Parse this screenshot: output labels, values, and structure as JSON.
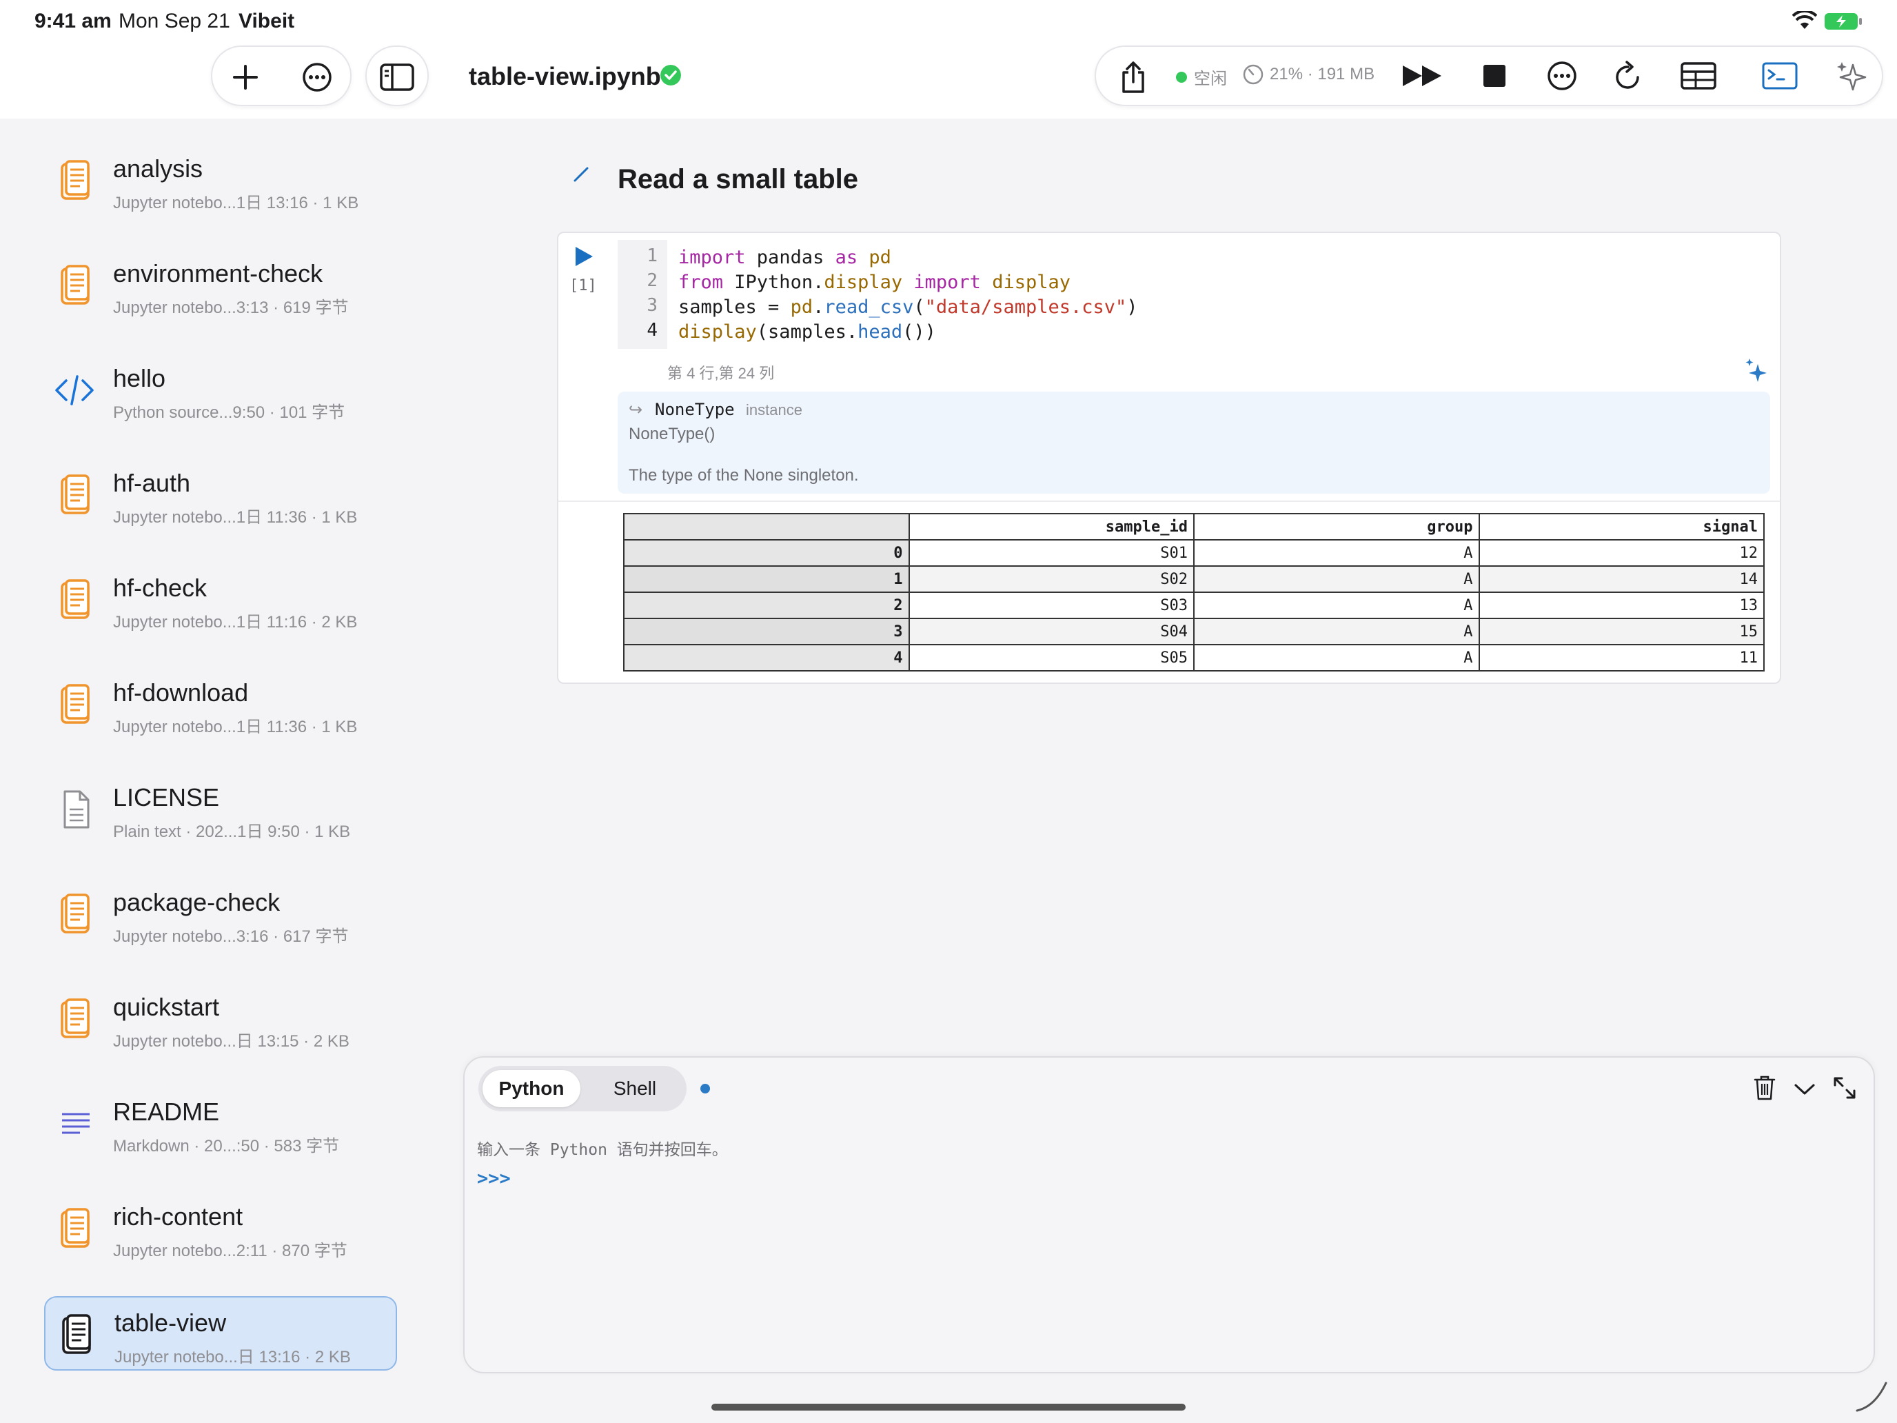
{
  "status_bar": {
    "time": "9:41 am",
    "date": "Mon Sep 21",
    "app": "Vibeit"
  },
  "toolbar": {
    "add_icon": "plus-icon",
    "more_icon": "ellipsis-circle-icon",
    "sidebar_icon": "sidebar-toggle-icon",
    "title": "table-view.ipynb",
    "saved_icon": "check-circle-icon",
    "share_icon": "share-icon",
    "kernel_status": "空闲",
    "kernel_usage": "21% · 191 MB",
    "run_all_icon": "run-all-icon",
    "stop_icon": "stop-icon",
    "menu_icon": "ellipsis-circle-icon",
    "restart_icon": "restart-icon",
    "table_icon": "table-icon",
    "console_icon": "terminal-icon",
    "ai_icon": "sparkles-icon",
    "accent": "#1a6fc0",
    "ok_color": "#34c759"
  },
  "sidebar": {
    "items": [
      {
        "name": "analysis",
        "meta": "Jupyter notebo...1日 13:16 · 1 KB",
        "icon": "notebook-icon"
      },
      {
        "name": "environment-check",
        "meta": "Jupyter notebo...3:13 · 619 字节",
        "icon": "notebook-icon"
      },
      {
        "name": "hello",
        "meta": "Python source...9:50 · 101 字节",
        "icon": "code-icon"
      },
      {
        "name": "hf-auth",
        "meta": "Jupyter notebo...1日 11:36 · 1 KB",
        "icon": "notebook-icon"
      },
      {
        "name": "hf-check",
        "meta": "Jupyter notebo...1日 11:16 · 2 KB",
        "icon": "notebook-icon"
      },
      {
        "name": "hf-download",
        "meta": "Jupyter notebo...1日 11:36 · 1 KB",
        "icon": "notebook-icon"
      },
      {
        "name": "LICENSE",
        "meta": "Plain text · 202...1日 9:50 · 1 KB",
        "icon": "document-icon"
      },
      {
        "name": "package-check",
        "meta": "Jupyter notebo...3:16 · 617 字节",
        "icon": "notebook-icon"
      },
      {
        "name": "quickstart",
        "meta": "Jupyter notebo...日 13:15 · 2 KB",
        "icon": "notebook-icon"
      },
      {
        "name": "README",
        "meta": "Markdown · 20...:50 · 583 字节",
        "icon": "markdown-icon"
      },
      {
        "name": "rich-content",
        "meta": "Jupyter notebo...2:11 · 870 字节",
        "icon": "notebook-icon"
      },
      {
        "name": "table-view",
        "meta": "Jupyter notebo...日 13:16 · 2 KB",
        "icon": "notebook-icon",
        "selected": true
      }
    ]
  },
  "notebook": {
    "markdown_heading": "Read a small table",
    "code_cell": {
      "exec_count": "[1]",
      "line_numbers": [
        "1",
        "2",
        "3",
        "4"
      ],
      "lines": [
        [
          {
            "t": "import",
            "c": "kw"
          },
          {
            "t": " pandas "
          },
          {
            "t": "as",
            "c": "kw"
          },
          {
            "t": " "
          },
          {
            "t": "pd",
            "c": "mod"
          }
        ],
        [
          {
            "t": "from",
            "c": "kw"
          },
          {
            "t": " IPython."
          },
          {
            "t": "display",
            "c": "mod"
          },
          {
            "t": " "
          },
          {
            "t": "import",
            "c": "kw"
          },
          {
            "t": " "
          },
          {
            "t": "display",
            "c": "mod"
          }
        ],
        [
          {
            "t": "samples = "
          },
          {
            "t": "pd",
            "c": "mod"
          },
          {
            "t": "."
          },
          {
            "t": "read_csv",
            "c": "fn"
          },
          {
            "t": "("
          },
          {
            "t": "\"data/samples.csv\"",
            "c": "str"
          },
          {
            "t": ")"
          }
        ],
        [
          {
            "t": "display",
            "c": "mod"
          },
          {
            "t": "(samples."
          },
          {
            "t": "head",
            "c": "fn"
          },
          {
            "t": "())"
          }
        ]
      ],
      "cursor_position": "第 4 行,第 24 列"
    },
    "tooltip": {
      "arrow": "↪",
      "type_name": "NoneType",
      "kind": "instance",
      "signature": "NoneType()",
      "doc": "The type of the None singleton."
    },
    "dataframe": {
      "columns": [
        "",
        "sample_id",
        "group",
        "signal"
      ],
      "rows": [
        [
          "0",
          "S01",
          "A",
          "12"
        ],
        [
          "1",
          "S02",
          "A",
          "14"
        ],
        [
          "2",
          "S03",
          "A",
          "13"
        ],
        [
          "3",
          "S04",
          "A",
          "15"
        ],
        [
          "4",
          "S05",
          "A",
          "11"
        ]
      ]
    }
  },
  "console": {
    "tabs": [
      "Python",
      "Shell"
    ],
    "active_tab": "Python",
    "hint": "输入一条 Python 语句并按回车。",
    "prompt": ">>>",
    "trash_icon": "trash-icon",
    "collapse_icon": "chevron-down-icon",
    "expand_icon": "expand-icon"
  }
}
